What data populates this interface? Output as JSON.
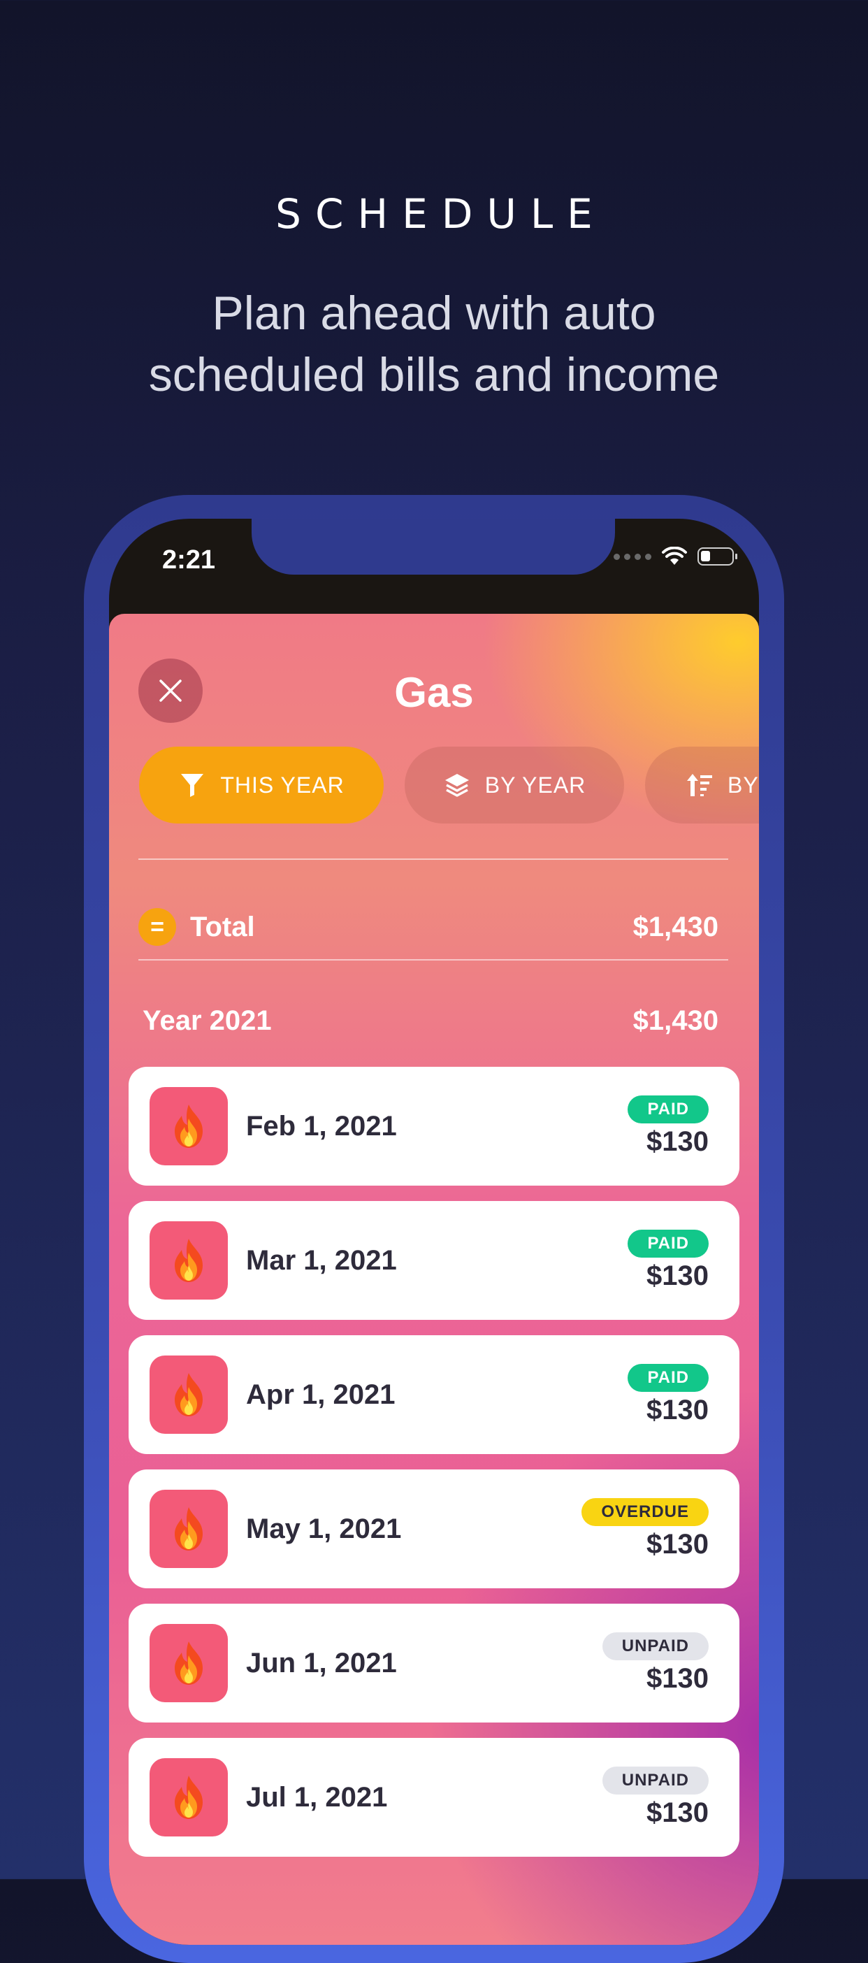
{
  "header": {
    "headline": "SCHEDULE",
    "tagline_line1": "Plan ahead with auto",
    "tagline_line2": "scheduled bills and income"
  },
  "status_bar": {
    "time": "2:21"
  },
  "sheet": {
    "title": "Gas",
    "filters": [
      {
        "label": "THIS YEAR",
        "icon": "filter-icon",
        "active": true
      },
      {
        "label": "BY YEAR",
        "icon": "layers-icon",
        "active": false
      },
      {
        "label": "BY",
        "icon": "sort-icon",
        "active": false
      }
    ],
    "total": {
      "label": "Total",
      "amount": "$1,430",
      "icon_text": "="
    },
    "year_group": {
      "label": "Year 2021",
      "amount": "$1,430"
    },
    "items": [
      {
        "date": "Feb 1, 2021",
        "status": "PAID",
        "amount": "$130",
        "icon": "fire-icon"
      },
      {
        "date": "Mar 1, 2021",
        "status": "PAID",
        "amount": "$130",
        "icon": "fire-icon"
      },
      {
        "date": "Apr 1, 2021",
        "status": "PAID",
        "amount": "$130",
        "icon": "fire-icon"
      },
      {
        "date": "May 1, 2021",
        "status": "OVERDUE",
        "amount": "$130",
        "icon": "fire-icon"
      },
      {
        "date": "Jun 1, 2021",
        "status": "UNPAID",
        "amount": "$130",
        "icon": "fire-icon"
      },
      {
        "date": "Jul 1, 2021",
        "status": "UNPAID",
        "amount": "$130",
        "icon": "fire-icon"
      }
    ]
  },
  "colors": {
    "paid": "#12c78a",
    "overdue": "#f9d412",
    "unpaid": "#e3e4ea",
    "accent": "#f7a30f"
  }
}
